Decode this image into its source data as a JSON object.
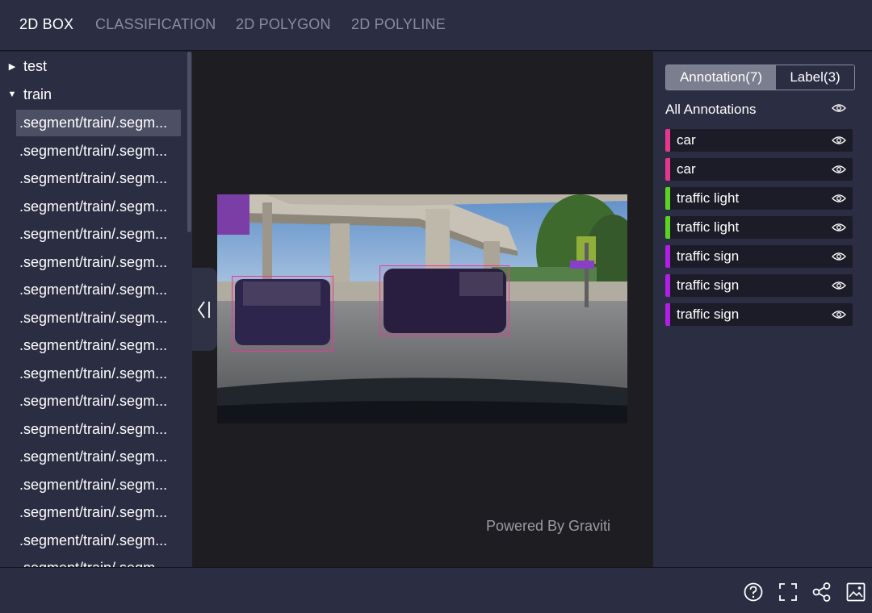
{
  "tabs": [
    "2D BOX",
    "CLASSIFICATION",
    "2D POLYGON",
    "2D POLYLINE"
  ],
  "tree": {
    "folders": [
      {
        "name": "test",
        "expanded": false
      },
      {
        "name": "train",
        "expanded": true
      }
    ],
    "files": [
      ".segment/train/.segm...",
      ".segment/train/.segm...",
      ".segment/train/.segm...",
      ".segment/train/.segm...",
      ".segment/train/.segm...",
      ".segment/train/.segm...",
      ".segment/train/.segm...",
      ".segment/train/.segm...",
      ".segment/train/.segm...",
      ".segment/train/.segm...",
      ".segment/train/.segm...",
      ".segment/train/.segm...",
      ".segment/train/.segm...",
      ".segment/train/.segm...",
      ".segment/train/.segm...",
      ".segment/train/.segm...",
      ".segment/train/.segm..."
    ],
    "selected_index": 0
  },
  "canvas": {
    "watermark": "Powered By Graviti",
    "box_color": "#e23c9c"
  },
  "panel": {
    "tab_annotation": "Annotation(7)",
    "tab_label": "Label(3)",
    "all_annotations": "All Annotations",
    "annotations": [
      {
        "label": "car",
        "color": "#e8358f"
      },
      {
        "label": "car",
        "color": "#e8358f"
      },
      {
        "label": "traffic light",
        "color": "#5ad41e"
      },
      {
        "label": "traffic light",
        "color": "#5ad41e"
      },
      {
        "label": "traffic sign",
        "color": "#b31ee6"
      },
      {
        "label": "traffic sign",
        "color": "#b31ee6"
      },
      {
        "label": "traffic sign",
        "color": "#b31ee6"
      }
    ]
  },
  "toolbar": {
    "icons": [
      "help-icon",
      "fullscreen-icon",
      "share-icon",
      "export-image-icon"
    ]
  }
}
